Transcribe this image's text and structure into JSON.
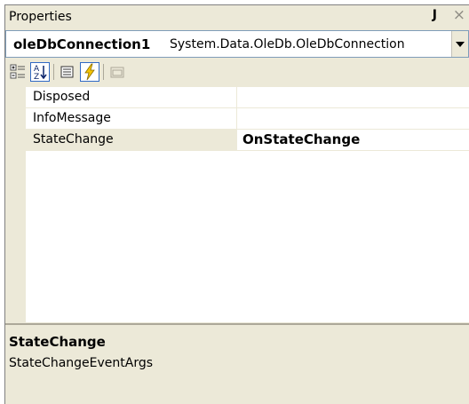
{
  "panel": {
    "title": "Properties",
    "pin_glyph": "ԧ",
    "close_glyph": "×"
  },
  "selector": {
    "object_name": "oleDbConnection1",
    "object_type": "System.Data.OleDb.OleDbConnection"
  },
  "toolbar": {
    "buttons": [
      {
        "icon": "categorized-icon",
        "active": false
      },
      {
        "icon": "alphabetical-icon",
        "active": true
      },
      {
        "icon": "properties-icon",
        "active": false
      },
      {
        "icon": "events-icon",
        "active": true
      },
      {
        "icon": "property-pages-icon",
        "active": false
      }
    ]
  },
  "events": [
    {
      "name": "Disposed",
      "value": ""
    },
    {
      "name": "InfoMessage",
      "value": ""
    },
    {
      "name": "StateChange",
      "value": "OnStateChange",
      "selected": true
    }
  ],
  "description": {
    "title": "StateChange",
    "text": "StateChangeEventArgs"
  },
  "colors": {
    "accent": "#316ac5",
    "face": "#ece9d8"
  }
}
